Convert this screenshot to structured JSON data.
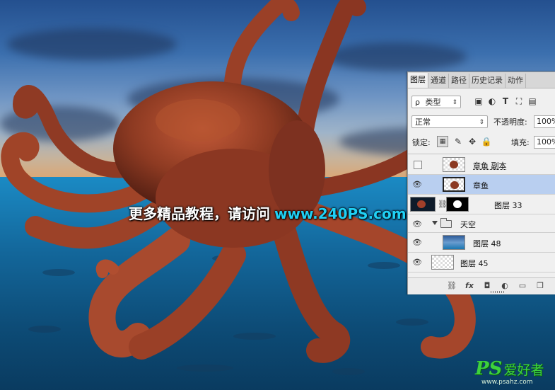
{
  "watermark": {
    "text_cn": "更多精品教程，请访问",
    "text_url": "www.240PS.com"
  },
  "site_logo": {
    "brand": "PS",
    "brand_cn": "爱好者",
    "url": "www.psahz.com"
  },
  "layers_panel": {
    "tabs": [
      "图层",
      "通道",
      "路径",
      "历史记录",
      "动作"
    ],
    "active_tab": "图层",
    "filter": {
      "prefix": "ρ",
      "value": "类型"
    },
    "blend_mode": "正常",
    "opacity_label": "不透明度:",
    "opacity_value": "100%",
    "lock_label": "锁定:",
    "fill_label": "填充:",
    "fill_value": "100%",
    "layers": [
      {
        "name": "章鱼 副本",
        "visible": false,
        "selected": false,
        "kind": "octopus"
      },
      {
        "name": "章鱼",
        "visible": true,
        "selected": true,
        "kind": "octopus"
      },
      {
        "name": "图层 33",
        "visible": true,
        "selected": false,
        "kind": "masked"
      },
      {
        "name": "天空",
        "visible": true,
        "selected": false,
        "kind": "group"
      },
      {
        "name": "图层 48",
        "visible": true,
        "selected": false,
        "kind": "sky-photo"
      },
      {
        "name": "图层 45",
        "visible": true,
        "selected": false,
        "kind": "empty"
      }
    ],
    "footer_icons": [
      "link-icon",
      "fx-icon",
      "mask-icon",
      "adjustment-icon",
      "folder-icon",
      "new-layer-icon"
    ],
    "footer_fx": "fx"
  },
  "colors": {
    "sky_top": "#24508f",
    "sea": "#13679b",
    "octopus": "#9a3f26",
    "watermark_url": "#1fd0f5",
    "logo": "#3dd13d",
    "selected_layer": "#b9cff0"
  }
}
